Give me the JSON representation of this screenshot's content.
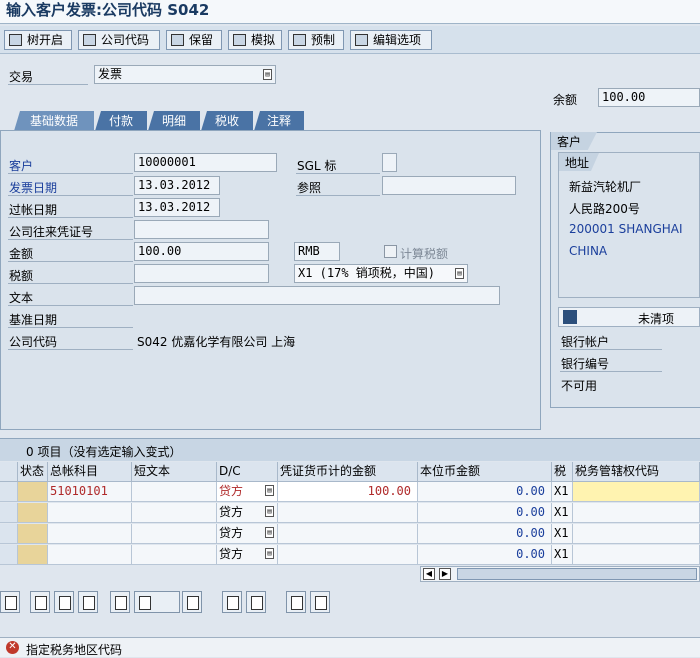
{
  "window_title": "输入客户发票:公司代码 S042",
  "toolbar": [
    {
      "label": "树开启",
      "icon": "tree-icon"
    },
    {
      "label": "公司代码",
      "icon": "company-icon"
    },
    {
      "label": "保留",
      "icon": "park-icon"
    },
    {
      "label": "模拟",
      "icon": "simulate-icon"
    },
    {
      "label": "预制",
      "icon": "save-icon"
    },
    {
      "label": "编辑选项",
      "icon": "edit-icon"
    }
  ],
  "transaction": {
    "label": "交易",
    "value": "发票"
  },
  "balance": {
    "label": "余额",
    "value": "100.00"
  },
  "tabs": [
    "基础数据",
    "付款",
    "明细",
    "税收",
    "注释"
  ],
  "basic": {
    "customer_label": "客户",
    "customer_value": "10000001",
    "invoice_date_label": "发票日期",
    "invoice_date_value": "13.03.2012",
    "posting_date_label": "过帐日期",
    "posting_date_value": "13.03.2012",
    "cross_cc_label": "公司往来凭证号",
    "cross_cc_value": "",
    "amount_label": "金额",
    "amount_value": "100.00",
    "currency": "RMB",
    "calc_tax_label": "计算税额",
    "tax_amount_label": "税额",
    "tax_amount_value": "",
    "tax_code_value": "X1 (17% 销项税，中国)",
    "text_label": "文本",
    "text_value": "",
    "baseline_date_label": "基准日期",
    "company_code_label": "公司代码",
    "company_code_value": "S042 优嘉化学有限公司 上海",
    "sgl_label": "SGL 标",
    "sgl_value": "",
    "reference_label": "参照",
    "reference_value": ""
  },
  "customer_panel": {
    "title": "客户",
    "address_label": "地址",
    "address_lines": [
      "新益汽轮机厂",
      "人民路200号",
      "200001 SHANGHAI",
      "CHINA"
    ],
    "open_items_label": "未清项",
    "bank_account_label": "银行帐户",
    "bank_number_label": "银行编号",
    "unavailable": "不可用"
  },
  "grid": {
    "title": "0 项目（没有选定输入变式）",
    "columns": [
      "状态",
      "总帐科目",
      "短文本",
      "D/C",
      "凭证货币计的金额",
      "本位币金额",
      "税",
      "税务管辖权代码"
    ],
    "rows": [
      {
        "gl": "51010101",
        "short": "",
        "dc": "贷方",
        "amt": "100.00",
        "local": "0.00",
        "tax": "X1",
        "juris": ""
      },
      {
        "gl": "",
        "short": "",
        "dc": "贷方",
        "amt": "",
        "local": "0.00",
        "tax": "X1",
        "juris": ""
      },
      {
        "gl": "",
        "short": "",
        "dc": "贷方",
        "amt": "",
        "local": "0.00",
        "tax": "X1",
        "juris": ""
      },
      {
        "gl": "",
        "short": "",
        "dc": "贷方",
        "amt": "",
        "local": "0.00",
        "tax": "X1",
        "juris": ""
      }
    ]
  },
  "status_bar": {
    "message": "指定税务地区代码",
    "icon": "error-icon"
  },
  "colors": {
    "accent_tab": "#4a73a5",
    "error": "#c0392b",
    "highlight_cell": "#fff3b0"
  }
}
